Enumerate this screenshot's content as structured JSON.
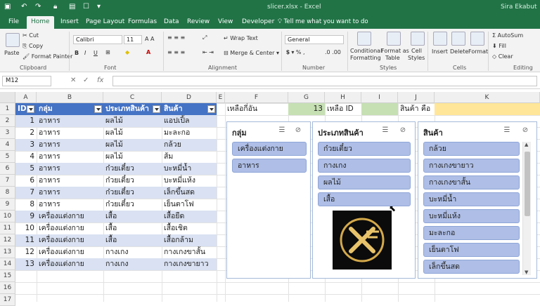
{
  "window": {
    "title": "slicer.xlsx - Excel",
    "user": "Sira Ekabut"
  },
  "tabs": [
    "File",
    "Home",
    "Insert",
    "Page Layout",
    "Formulas",
    "Data",
    "Review",
    "View",
    "Developer"
  ],
  "tell_me": "Tell me what you want to do",
  "ribbon": {
    "clipboard": {
      "paste": "Paste",
      "cut": "Cut",
      "copy": "Copy",
      "format_painter": "Format Painter",
      "label": "Clipboard"
    },
    "font": {
      "name": "Calibri",
      "size": "11",
      "label": "Font"
    },
    "alignment": {
      "wrap": "Wrap Text",
      "merge": "Merge & Center",
      "label": "Alignment"
    },
    "number": {
      "format": "General",
      "label": "Number"
    },
    "styles": {
      "conditional": "Conditional",
      "conditional2": "Formatting",
      "format_table": "Format as",
      "format_table2": "Table",
      "cell_styles": "Cell",
      "cell_styles2": "Styles",
      "label": "Styles"
    },
    "cells": {
      "insert": "Insert",
      "delete": "Delete",
      "format": "Format",
      "label": "Cells"
    },
    "editing": {
      "autosum": "AutoSum",
      "fill": "Fill",
      "clear": "Clear",
      "label": "Editing"
    }
  },
  "formula_bar": {
    "name_box": "M12",
    "formula": ""
  },
  "columns": [
    "A",
    "B",
    "C",
    "D",
    "E",
    "F",
    "G",
    "H",
    "I",
    "J",
    "K"
  ],
  "rows": [
    "1",
    "2",
    "3",
    "4",
    "5",
    "6",
    "7",
    "8",
    "9",
    "10",
    "11",
    "12",
    "13",
    "14",
    "15",
    "16",
    "17"
  ],
  "table": {
    "headers": [
      "ID",
      "กลุ่ม",
      "ประเภทสินค้า",
      "สินค้า"
    ],
    "rows": [
      [
        "1",
        "อาหาร",
        "ผลไม้",
        "แอปเปิ้ล"
      ],
      [
        "2",
        "อาหาร",
        "ผลไม้",
        "มะละกอ"
      ],
      [
        "3",
        "อาหาร",
        "ผลไม้",
        "กล้วย"
      ],
      [
        "4",
        "อาหาร",
        "ผลไม้",
        "ส้ม"
      ],
      [
        "5",
        "อาหาร",
        "ก๋วยเตี๋ยว",
        "บะหมี่น้ำ"
      ],
      [
        "6",
        "อาหาร",
        "ก๋วยเตี๋ยว",
        "บะหมี่แห้ง"
      ],
      [
        "7",
        "อาหาร",
        "ก๋วยเตี๋ยว",
        "เล็กขึ้นสด"
      ],
      [
        "8",
        "อาหาร",
        "ก๋วยเตี๋ยว",
        "เย็นตาโฟ"
      ],
      [
        "9",
        "เครื่องแต่งกาย",
        "เสื้อ",
        "เสื้อยืด"
      ],
      [
        "10",
        "เครื่องแต่งกาย",
        "เสื้อ",
        "เสื้อเชิต"
      ],
      [
        "11",
        "เครื่องแต่งกาย",
        "เสื้อ",
        "เสื้อกล้าม"
      ],
      [
        "12",
        "เครื่องแต่งกาย",
        "กางเกง",
        "กางเกงขาสั้น"
      ],
      [
        "13",
        "เครื่องแต่งกาย",
        "กางเกง",
        "กางเกงขายาว"
      ]
    ]
  },
  "row1_extra": {
    "f1": "เหลือกี่อัน",
    "g1": "13",
    "h1": "เหลือ ID",
    "j1": "สินค้า คือ"
  },
  "colors": {
    "header_blue": "#4472c4",
    "band_blue": "#d9e1f2",
    "excel_green": "#217346",
    "slicer_button": "#aebee6"
  },
  "slicers": [
    {
      "title": "กลุ่ม",
      "items": [
        "เครื่องแต่งกาย",
        "อาหาร"
      ]
    },
    {
      "title": "ประเภทสินค้า",
      "items": [
        "ก๋วยเตี๋ยว",
        "กางเกง",
        "ผลไม้",
        "เสื้อ"
      ]
    },
    {
      "title": "สินค้า",
      "items": [
        "กล้วย",
        "กางเกงขายาว",
        "กางเกงขาสั้น",
        "บะหมี่น้ำ",
        "บะหมี่แห้ง",
        "มะละกอ",
        "เย็นตาโฟ",
        "เล็กขึ้นสด"
      ]
    }
  ]
}
